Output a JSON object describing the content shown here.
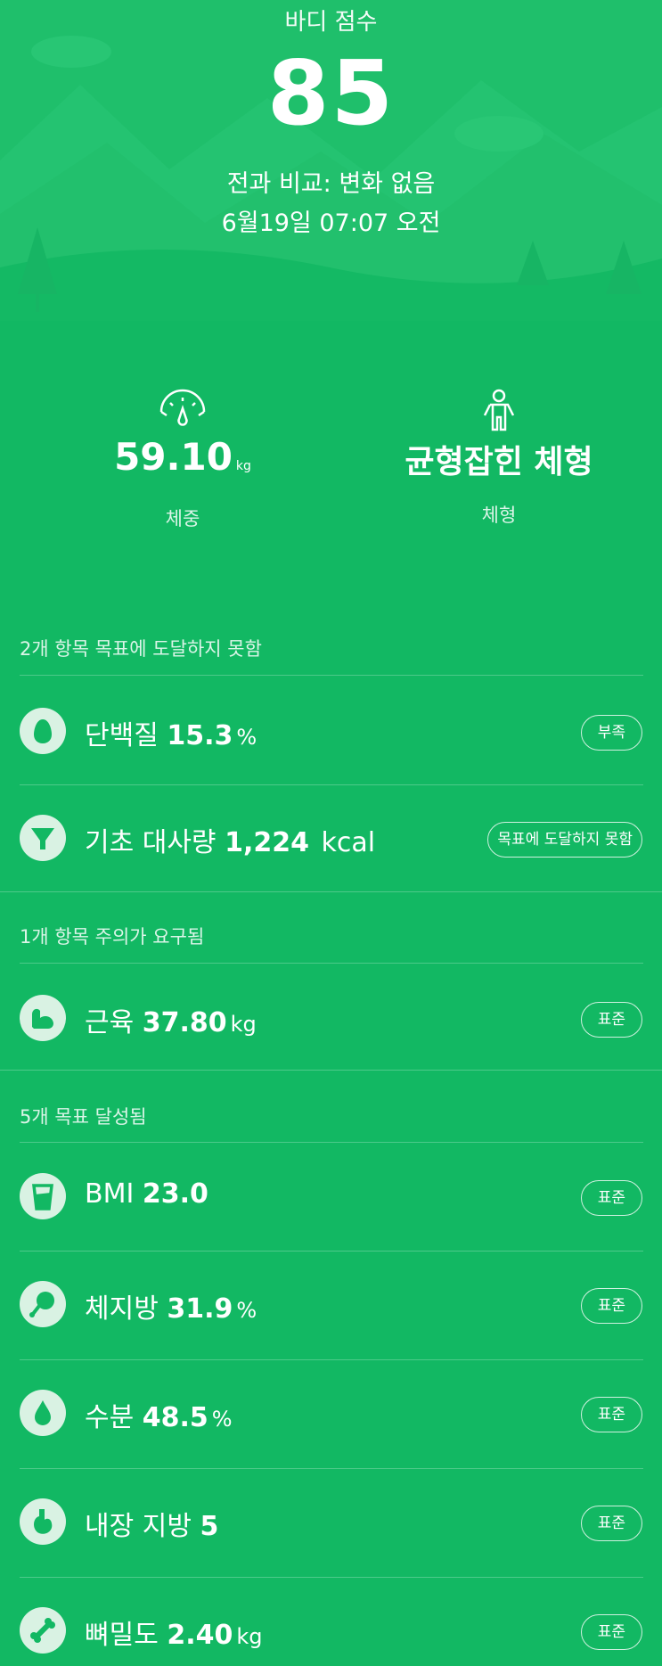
{
  "header": {
    "score_label": "바디 점수",
    "score_value": "85",
    "compare_text": "전과 비교: 변화 없음",
    "datetime": "6월19일 07:07 오전"
  },
  "stats": {
    "weight": {
      "value": "59.10",
      "unit": "kg",
      "caption": "체중",
      "icon": "scale-icon"
    },
    "body_type": {
      "value": "균형잡힌 체형",
      "caption": "체형",
      "icon": "person-icon"
    }
  },
  "sections": [
    {
      "header": "2개 항목 목표에 도달하지 못함"
    },
    {
      "header": "1개 항목 주의가 요구됨"
    },
    {
      "header": "5개 목표 달성됨"
    }
  ],
  "metrics": [
    {
      "name": "단백질",
      "value": "15.3",
      "unit": "%",
      "badge": "부족",
      "icon": "egg-icon"
    },
    {
      "name": "기초 대사량",
      "value": "1,224",
      "unit": "kcal",
      "badge": "목표에 도달하지 못함",
      "icon": "funnel-icon"
    },
    {
      "name": "근육",
      "value": "37.80",
      "unit": "kg",
      "badge": "표준",
      "icon": "muscle-icon"
    },
    {
      "name": "BMI",
      "value": "23.0",
      "unit": "",
      "badge": "표준",
      "icon": "cup-icon"
    },
    {
      "name": "체지방",
      "value": "31.9",
      "unit": "%",
      "badge": "표준",
      "icon": "drumstick-icon"
    },
    {
      "name": "수분",
      "value": "48.5",
      "unit": "%",
      "badge": "표준",
      "icon": "water-drop-icon"
    },
    {
      "name": "내장 지방",
      "value": "5",
      "unit": "",
      "badge": "표준",
      "icon": "stomach-icon"
    },
    {
      "name": "뼈밀도",
      "value": "2.40",
      "unit": "kg",
      "badge": "표준",
      "icon": "bone-icon"
    }
  ],
  "colors": {
    "background": "#12b863",
    "icon_circle": "#d9f2e3",
    "icon_glyph": "#12b863"
  }
}
